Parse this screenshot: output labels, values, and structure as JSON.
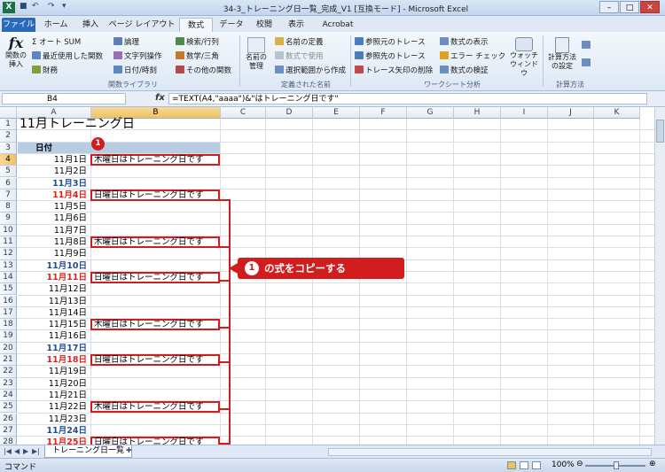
{
  "window": {
    "title": "34-3_トレーニング日一覧_完成_V1 [互換モード] - Microsoft Excel"
  },
  "tabs": [
    "ファイル",
    "ホーム",
    "挿入",
    "ページ レイアウト",
    "数式",
    "データ",
    "校閲",
    "表示",
    "Acrobat"
  ],
  "ribbon": {
    "insert_fn": "関数の挿入",
    "autosum": "オート SUM",
    "recent": "最近使用した関数",
    "finance": "財務",
    "logical": "論理",
    "text": "文字列操作",
    "datetime": "日付/時刻",
    "lookup": "検索/行列",
    "math": "数学/三角",
    "other": "その他の関数",
    "group_library": "関数ライブラリ",
    "name_mgr": "名前の管理",
    "define_name": "名前の定義",
    "use_in_formula": "数式で使用",
    "create_from_sel": "選択範囲から作成",
    "group_names": "定義された名前",
    "trace_prec": "参照元のトレース",
    "trace_dep": "参照先のトレース",
    "remove_arrows": "トレース矢印の削除",
    "show_formulas": "数式の表示",
    "error_check": "エラー チェック",
    "eval_formula": "数式の検証",
    "watch": "ウォッチ ウィンドウ",
    "group_audit": "ワークシート分析",
    "calc_options": "計算方法の設定",
    "group_calc": "計算方法"
  },
  "formula_bar": {
    "name_box": "B4",
    "fx": "fx",
    "formula": "=TEXT(A4,\"aaaa\")&\"はトレーニング日です\""
  },
  "columns": [
    "A",
    "B",
    "C",
    "D",
    "E",
    "F",
    "G",
    "H",
    "I",
    "J",
    "K"
  ],
  "rows": [
    {
      "n": "1",
      "a": "11月トレーニング日",
      "kind": "title"
    },
    {
      "n": "2",
      "a": ""
    },
    {
      "n": "3",
      "a": "日付",
      "kind": "header"
    },
    {
      "n": "4",
      "a": "11月1日",
      "b": "木曜日はトレーニング日です"
    },
    {
      "n": "5",
      "a": "11月2日"
    },
    {
      "n": "6",
      "a": "11月3日",
      "kind": "sat"
    },
    {
      "n": "7",
      "a": "11月4日",
      "kind": "sun",
      "b": "日曜日はトレーニング日です"
    },
    {
      "n": "8",
      "a": "11月5日"
    },
    {
      "n": "9",
      "a": "11月6日"
    },
    {
      "n": "10",
      "a": "11月7日"
    },
    {
      "n": "11",
      "a": "11月8日",
      "b": "木曜日はトレーニング日です"
    },
    {
      "n": "12",
      "a": "11月9日"
    },
    {
      "n": "13",
      "a": "11月10日",
      "kind": "sat"
    },
    {
      "n": "14",
      "a": "11月11日",
      "kind": "sun",
      "b": "日曜日はトレーニング日です"
    },
    {
      "n": "15",
      "a": "11月12日"
    },
    {
      "n": "16",
      "a": "11月13日"
    },
    {
      "n": "17",
      "a": "11月14日"
    },
    {
      "n": "18",
      "a": "11月15日",
      "b": "木曜日はトレーニング日です"
    },
    {
      "n": "19",
      "a": "11月16日"
    },
    {
      "n": "20",
      "a": "11月17日",
      "kind": "sat"
    },
    {
      "n": "21",
      "a": "11月18日",
      "kind": "sun",
      "b": "日曜日はトレーニング日です"
    },
    {
      "n": "22",
      "a": "11月19日"
    },
    {
      "n": "23",
      "a": "11月20日"
    },
    {
      "n": "24",
      "a": "11月21日"
    },
    {
      "n": "25",
      "a": "11月22日",
      "b": "木曜日はトレーニング日です"
    },
    {
      "n": "26",
      "a": "11月23日"
    },
    {
      "n": "27",
      "a": "11月24日",
      "kind": "sat"
    },
    {
      "n": "28",
      "a": "11月25日",
      "kind": "sun",
      "b": "日曜日はトレーニング日です"
    }
  ],
  "annotation": {
    "badge": "1",
    "callout_num": "1",
    "callout_text": "の式をコピーする"
  },
  "sheet_tab": "トレーニング日一覧",
  "status": {
    "mode": "コマンド",
    "zoom": "100%"
  },
  "colors": {
    "accent_red": "#d11d1d",
    "sunday": "#e3221a",
    "saturday": "#1f4c9a",
    "header_fill": "#b8cce4"
  }
}
